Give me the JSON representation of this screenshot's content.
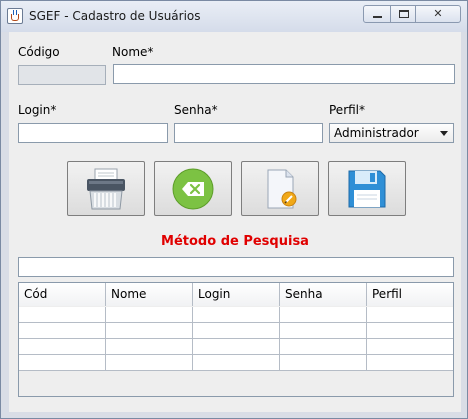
{
  "window": {
    "title": "SGEF - Cadastro de Usuários",
    "controls": {
      "minimize": "minimize-icon",
      "maximize": "maximize-icon",
      "close": "✕"
    }
  },
  "form": {
    "codigo": {
      "label": "Código",
      "value": ""
    },
    "nome": {
      "label": "Nome*",
      "value": ""
    },
    "login": {
      "label": "Login*",
      "value": ""
    },
    "senha": {
      "label": "Senha*",
      "value": ""
    },
    "perfil": {
      "label": "Perfil*",
      "selected": "Administrador"
    }
  },
  "toolbar": {
    "buttons": [
      {
        "name": "delete-button",
        "icon": "shredder-icon"
      },
      {
        "name": "clear-button",
        "icon": "backspace-icon"
      },
      {
        "name": "edit-button",
        "icon": "edit-document-icon"
      },
      {
        "name": "save-button",
        "icon": "floppy-disk-icon"
      }
    ]
  },
  "search": {
    "title": "Método de Pesquisa",
    "value": "",
    "accent_color": "#e00000"
  },
  "table": {
    "columns": [
      "Cód",
      "Nome",
      "Login",
      "Senha",
      "Perfil"
    ],
    "rows": [
      [
        "",
        "",
        "",
        "",
        ""
      ],
      [
        "",
        "",
        "",
        "",
        ""
      ],
      [
        "",
        "",
        "",
        "",
        ""
      ],
      [
        "",
        "",
        "",
        "",
        ""
      ]
    ]
  }
}
